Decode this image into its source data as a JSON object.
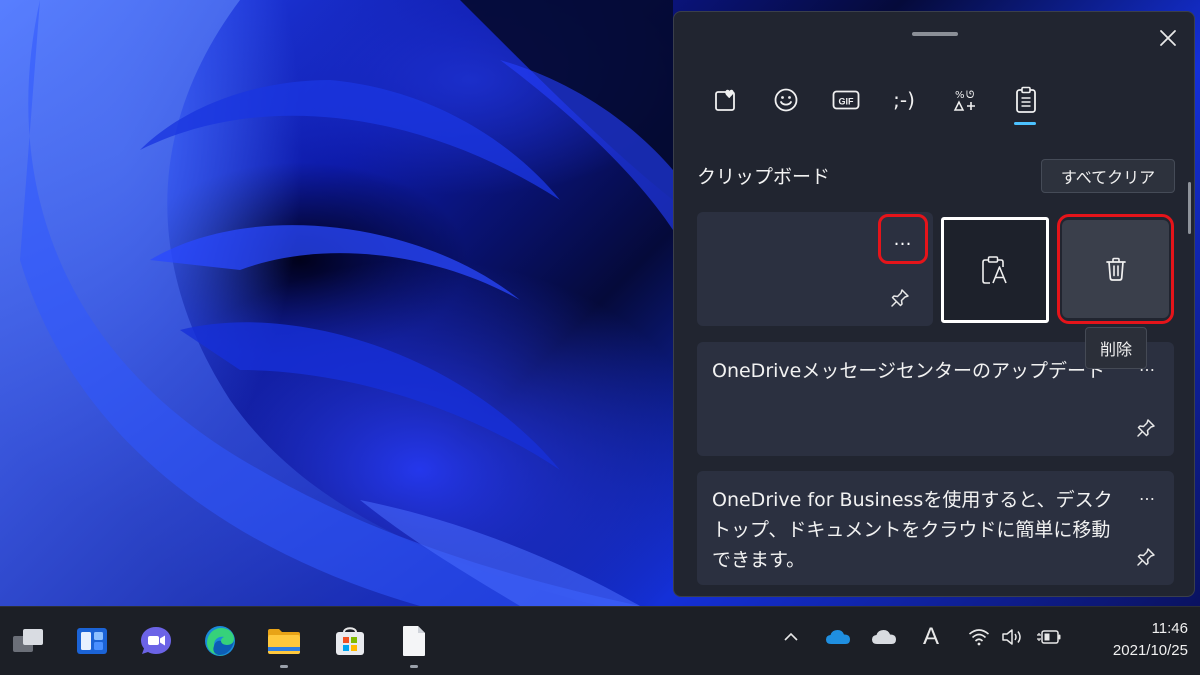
{
  "panel": {
    "tabs": [
      {
        "name": "favorites",
        "icon": "heart-card-icon",
        "label": ""
      },
      {
        "name": "emoji",
        "icon": "smiley-icon",
        "label": ""
      },
      {
        "name": "gif",
        "icon": "gif-icon",
        "label": "GIF"
      },
      {
        "name": "kaomoji",
        "icon": "kaomoji-icon",
        "label": ";-)"
      },
      {
        "name": "symbols",
        "icon": "symbols-icon",
        "label": ""
      },
      {
        "name": "clipboard",
        "icon": "clipboard-icon",
        "label": ""
      }
    ],
    "active_tab": "clipboard",
    "section_title": "クリップボード",
    "clear_all_label": "すべてクリア",
    "item_more_label": "…",
    "delete_tooltip": "削除",
    "items": [
      {
        "text": "OneDriveメッセージセンターのアップデート"
      },
      {
        "text": "OneDrive for Businessを使用すると、デスクトップ、ドキュメントをクラウドに簡単に移動できます。"
      }
    ]
  },
  "taskbar": {
    "apps": [
      "task-view",
      "widgets",
      "teams-chat",
      "edge",
      "file-explorer",
      "store",
      "notepad"
    ],
    "tray_ime_label": "A",
    "time": "11:46",
    "date": "2021/10/25"
  },
  "colors": {
    "accent": "#4cc2ff",
    "highlight": "#e5141a",
    "panel_bg": "#212530",
    "item_bg": "#2b3040"
  }
}
